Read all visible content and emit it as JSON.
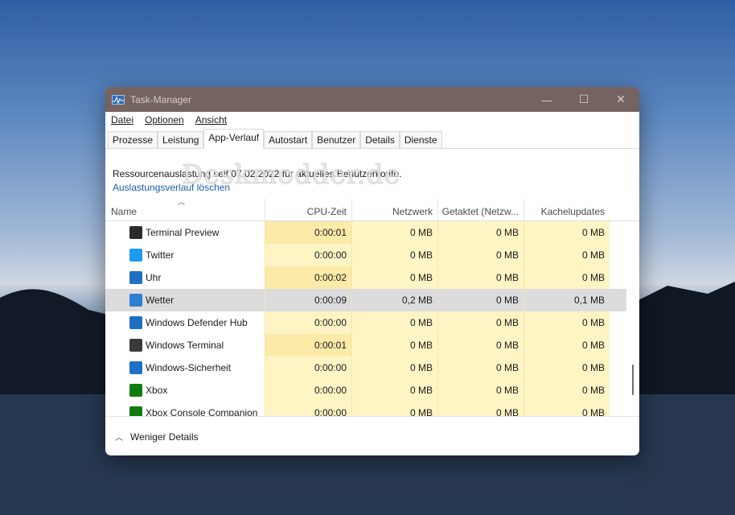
{
  "window": {
    "title": "Task-Manager",
    "controls": {
      "minimize": "—",
      "maximize": "☐",
      "close": "✕"
    }
  },
  "menu": [
    "Datei",
    "Optionen",
    "Ansicht"
  ],
  "tabs": [
    "Prozesse",
    "Leistung",
    "App-Verlauf",
    "Autostart",
    "Benutzer",
    "Details",
    "Dienste"
  ],
  "active_tab": "App-Verlauf",
  "info": {
    "summary": "Ressourcenauslastung seit 07.02.2022 für aktuelles Benutzerkonto.",
    "clear_link": "Auslastungsverlauf löschen"
  },
  "columns": [
    "Name",
    "CPU-Zeit",
    "Netzwerk",
    "Getaktet (Netzw...",
    "Kachelupdates"
  ],
  "rows": [
    {
      "name": "Terminal Preview",
      "cpu": "0:00:01",
      "net": "0 MB",
      "metered": "0 MB",
      "tiles": "0 MB",
      "icon": "terminal-preview-icon",
      "color": "#2b2b2b"
    },
    {
      "name": "Twitter",
      "cpu": "0:00:00",
      "net": "0 MB",
      "metered": "0 MB",
      "tiles": "0 MB",
      "icon": "twitter-icon",
      "color": "#1d9bf0"
    },
    {
      "name": "Uhr",
      "cpu": "0:00:02",
      "net": "0 MB",
      "metered": "0 MB",
      "tiles": "0 MB",
      "icon": "clock-icon",
      "color": "#1f6fc4"
    },
    {
      "name": "Wetter",
      "cpu": "0:00:09",
      "net": "0,2 MB",
      "metered": "0 MB",
      "tiles": "0,1 MB",
      "icon": "weather-icon",
      "color": "#2e7fd1"
    },
    {
      "name": "Windows Defender Hub",
      "cpu": "0:00:00",
      "net": "0 MB",
      "metered": "0 MB",
      "tiles": "0 MB",
      "icon": "defender-icon",
      "color": "#1f6fc4"
    },
    {
      "name": "Windows Terminal",
      "cpu": "0:00:01",
      "net": "0 MB",
      "metered": "0 MB",
      "tiles": "0 MB",
      "icon": "terminal-icon",
      "color": "#3a3a3a"
    },
    {
      "name": "Windows-Sicherheit",
      "cpu": "0:00:00",
      "net": "0 MB",
      "metered": "0 MB",
      "tiles": "0 MB",
      "icon": "security-icon",
      "color": "#1f6fc4"
    },
    {
      "name": "Xbox",
      "cpu": "0:00:00",
      "net": "0 MB",
      "metered": "0 MB",
      "tiles": "0 MB",
      "icon": "xbox-icon",
      "color": "#107c10"
    },
    {
      "name": "Xbox Console Companion",
      "cpu": "0:00:00",
      "net": "0 MB",
      "metered": "0 MB",
      "tiles": "0 MB",
      "icon": "xbox-companion-icon",
      "color": "#107c10"
    }
  ],
  "selected_row": "Wetter",
  "footer": {
    "toggle_label": "Weniger Details"
  },
  "watermark": "Deskmodder.de"
}
